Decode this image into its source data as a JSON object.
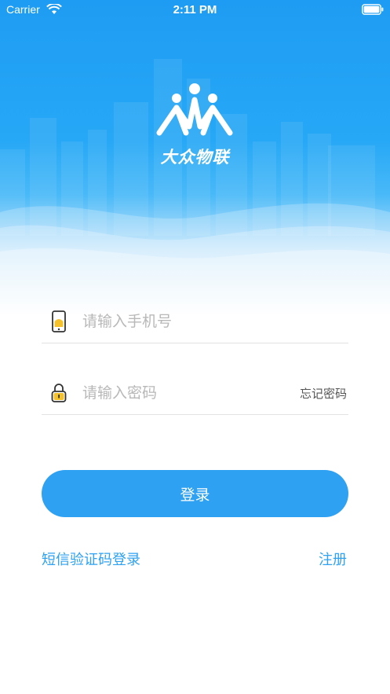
{
  "status_bar": {
    "carrier": "Carrier",
    "time": "2:11 PM",
    "wifi_icon": "wifi-icon",
    "battery_icon": "battery-icon"
  },
  "brand": {
    "name": "大众物联",
    "logo_icon": "people-logo-icon"
  },
  "form": {
    "phone": {
      "placeholder": "请输入手机号",
      "value": "",
      "icon": "phone-icon"
    },
    "password": {
      "placeholder": "请输入密码",
      "value": "",
      "icon": "lock-icon"
    },
    "forgot_label": "忘记密码"
  },
  "login_button_label": "登录",
  "links": {
    "sms_login": "短信验证码登录",
    "register": "注册"
  },
  "colors": {
    "accent": "#2ea1f2",
    "header_top": "#1e9cf3",
    "divider": "#e2e2e2",
    "icon_yellow": "#f5c22c"
  }
}
